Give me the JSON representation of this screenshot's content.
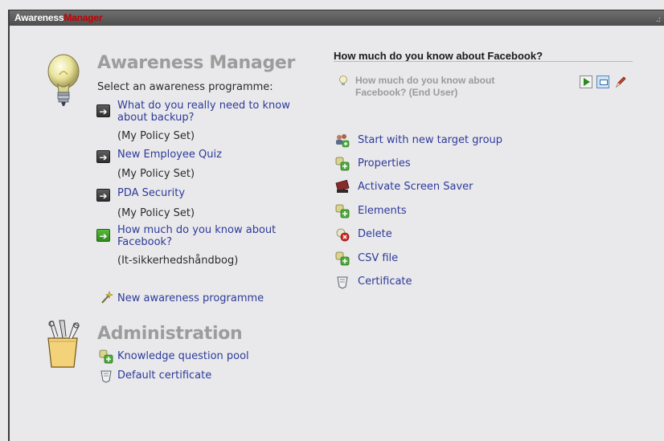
{
  "window": {
    "brand_part1": "Awareness",
    "brand_part2": "Manager",
    "corner_mark": ".:",
    "colors": {
      "brand_accent": "#c40000",
      "link": "#2e3a9a",
      "heading": "#9c9c9c"
    }
  },
  "left": {
    "section_title": "Awareness Manager",
    "subtitle": "Select an awareness programme:",
    "programmes": [
      {
        "label": "What do you really need to know about backup?",
        "policy": "(My Policy Set)"
      },
      {
        "label": "New Employee Quiz",
        "policy": "(My Policy Set)"
      },
      {
        "label": "PDA Security",
        "policy": "(My Policy Set)"
      },
      {
        "label": "How much do you know about Facebook?",
        "policy": "(It-sikkerhedshåndbog)"
      }
    ],
    "new_programme_label": "New awareness programme",
    "admin_title": "Administration",
    "admin_links": [
      {
        "label": "Knowledge question pool",
        "icon": "add-item-icon"
      },
      {
        "label": "Default certificate",
        "icon": "certificate-icon"
      }
    ]
  },
  "right": {
    "header": "How much do you know about Facebook?",
    "selected_item": "How much do you know about Facebook? (End User)",
    "actions": [
      {
        "label": "Start with new target group",
        "icon": "target-group-icon"
      },
      {
        "label": "Properties",
        "icon": "properties-icon"
      },
      {
        "label": "Activate Screen Saver",
        "icon": "screen-saver-icon"
      },
      {
        "label": "Elements",
        "icon": "elements-icon"
      },
      {
        "label": "Delete",
        "icon": "delete-icon"
      },
      {
        "label": "CSV file",
        "icon": "csv-icon"
      },
      {
        "label": "Certificate",
        "icon": "certificate-icon"
      }
    ]
  }
}
